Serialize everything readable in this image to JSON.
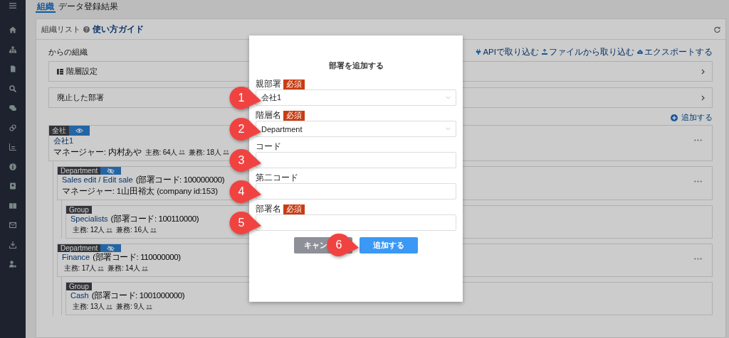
{
  "tabs": [
    {
      "label": "組織",
      "selected": true
    },
    {
      "label": "データ登録結果",
      "selected": false
    }
  ],
  "panel": {
    "title": "組織リスト",
    "guide_link": "使い方ガイド",
    "section_title": "からの組織",
    "actions": [
      {
        "label": "APIで取り込む",
        "kind": "api"
      },
      {
        "label": "ファイルから取り込む",
        "kind": "file"
      },
      {
        "label": "エクスポートする",
        "kind": "export"
      }
    ],
    "accordions": [
      {
        "label": "階層設定",
        "kind": "hierarchy"
      },
      {
        "label": "廃止した部署",
        "kind": "plain"
      }
    ],
    "add_link": "追加する"
  },
  "tree": [
    {
      "tag": "全社",
      "visible": true,
      "name": "会社1",
      "manager": "マネージャー: 内村あや",
      "counts": [
        "主務: 64人",
        "兼務: 18人"
      ],
      "more_menu": true,
      "children": [
        {
          "tag": "Department",
          "visible": false,
          "name": "Sales edit / Edit sale",
          "code": "(部署コード: 100000000)",
          "manager": "マネージャー: 1山田裕太 (company id:153)",
          "more_menu": true,
          "children": [
            {
              "tag": "Group",
              "name": "Specialists",
              "code": "(部署コード: 100110000)",
              "counts": [
                "主務: 12人",
                "兼務: 16人"
              ],
              "more_menu": false
            }
          ]
        },
        {
          "tag": "Department",
          "visible": false,
          "name": "Finance",
          "code": "(部署コード: 110000000)",
          "counts": [
            "主務: 17人",
            "兼務: 14人"
          ],
          "more_menu": true,
          "children": [
            {
              "tag": "Group",
              "name": "Cash",
              "code": "(部署コード: 1001000000)",
              "counts": [
                "主務: 13人",
                "兼務: 9人"
              ],
              "more_menu": false
            }
          ]
        }
      ]
    }
  ],
  "dialog": {
    "title": "部署を追加する",
    "fields": [
      {
        "label": "親部署",
        "required": true,
        "required_badge": "必須",
        "kind": "select",
        "value": "会社1",
        "callout": "1"
      },
      {
        "label": "階層名",
        "required": true,
        "required_badge": "必須",
        "kind": "select",
        "value": "Department",
        "callout": "2"
      },
      {
        "label": "コード",
        "required": false,
        "kind": "text",
        "callout": "3"
      },
      {
        "label": "第二コード",
        "required": false,
        "kind": "text",
        "callout": "4"
      },
      {
        "label": "部署名",
        "required": true,
        "required_badge": "必須",
        "kind": "text",
        "callout": "5"
      }
    ],
    "cancel_button": "キャン",
    "submit_button": "追加する",
    "submit_callout": "6"
  }
}
